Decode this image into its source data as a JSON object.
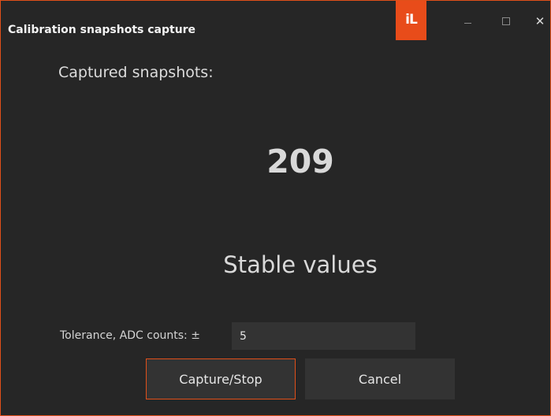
{
  "window": {
    "title": "Calibration snapshots capture",
    "logo_text": "iL",
    "controls": {
      "minimize": "minimize-icon",
      "maximize": "maximize-icon",
      "close": "close-icon",
      "close_glyph": "✕"
    },
    "accent_color": "#e84c1a"
  },
  "main": {
    "captured_label": "Captured snapshots:",
    "captured_count": "209",
    "status_text": "Stable values"
  },
  "tolerance": {
    "label": "Tolerance, ADC counts: ±",
    "value": "5"
  },
  "buttons": {
    "capture_stop": "Capture/Stop",
    "cancel": "Cancel"
  }
}
